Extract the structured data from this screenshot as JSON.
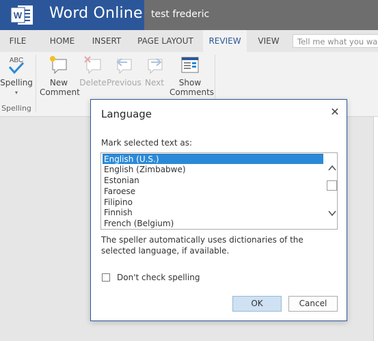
{
  "app": {
    "brand": "Word Online",
    "doc_title": "test frederic",
    "accent": "#2b579a"
  },
  "tabs": [
    {
      "label": "FILE",
      "active": false
    },
    {
      "label": "HOME",
      "active": false
    },
    {
      "label": "INSERT",
      "active": false
    },
    {
      "label": "PAGE LAYOUT",
      "active": false
    },
    {
      "label": "REVIEW",
      "active": true
    },
    {
      "label": "VIEW",
      "active": false
    }
  ],
  "search": {
    "placeholder": "Tell me what you want to do"
  },
  "ribbon": {
    "spelling": {
      "label": "Spelling",
      "icon": "abc-check-icon"
    },
    "spelling_group": "Spelling",
    "new_comment": {
      "line1": "New",
      "line2": "Comment",
      "icon": "new-comment-icon"
    },
    "delete": {
      "label": "Delete",
      "icon": "delete-comment-icon",
      "disabled": true
    },
    "previous": {
      "label": "Previous",
      "icon": "previous-comment-icon",
      "disabled": true
    },
    "next": {
      "label": "Next",
      "icon": "next-comment-icon",
      "disabled": true
    },
    "show_comments": {
      "line1": "Show",
      "line2": "Comments",
      "icon": "show-comments-icon"
    }
  },
  "dialog": {
    "title": "Language",
    "close_icon": "close-icon",
    "list_label": "Mark selected text as:",
    "languages": [
      {
        "label": "English (U.S.)",
        "selected": true
      },
      {
        "label": "English (Zimbabwe)",
        "selected": false
      },
      {
        "label": "Estonian",
        "selected": false
      },
      {
        "label": "Faroese",
        "selected": false
      },
      {
        "label": "Filipino",
        "selected": false
      },
      {
        "label": "Finnish",
        "selected": false
      },
      {
        "label": "French (Belgium)",
        "selected": false
      }
    ],
    "note": "The speller automatically uses dictionaries of the selected language, if available.",
    "dont_check_label": "Don't check spelling",
    "dont_check_checked": false,
    "ok_label": "OK",
    "cancel_label": "Cancel"
  }
}
